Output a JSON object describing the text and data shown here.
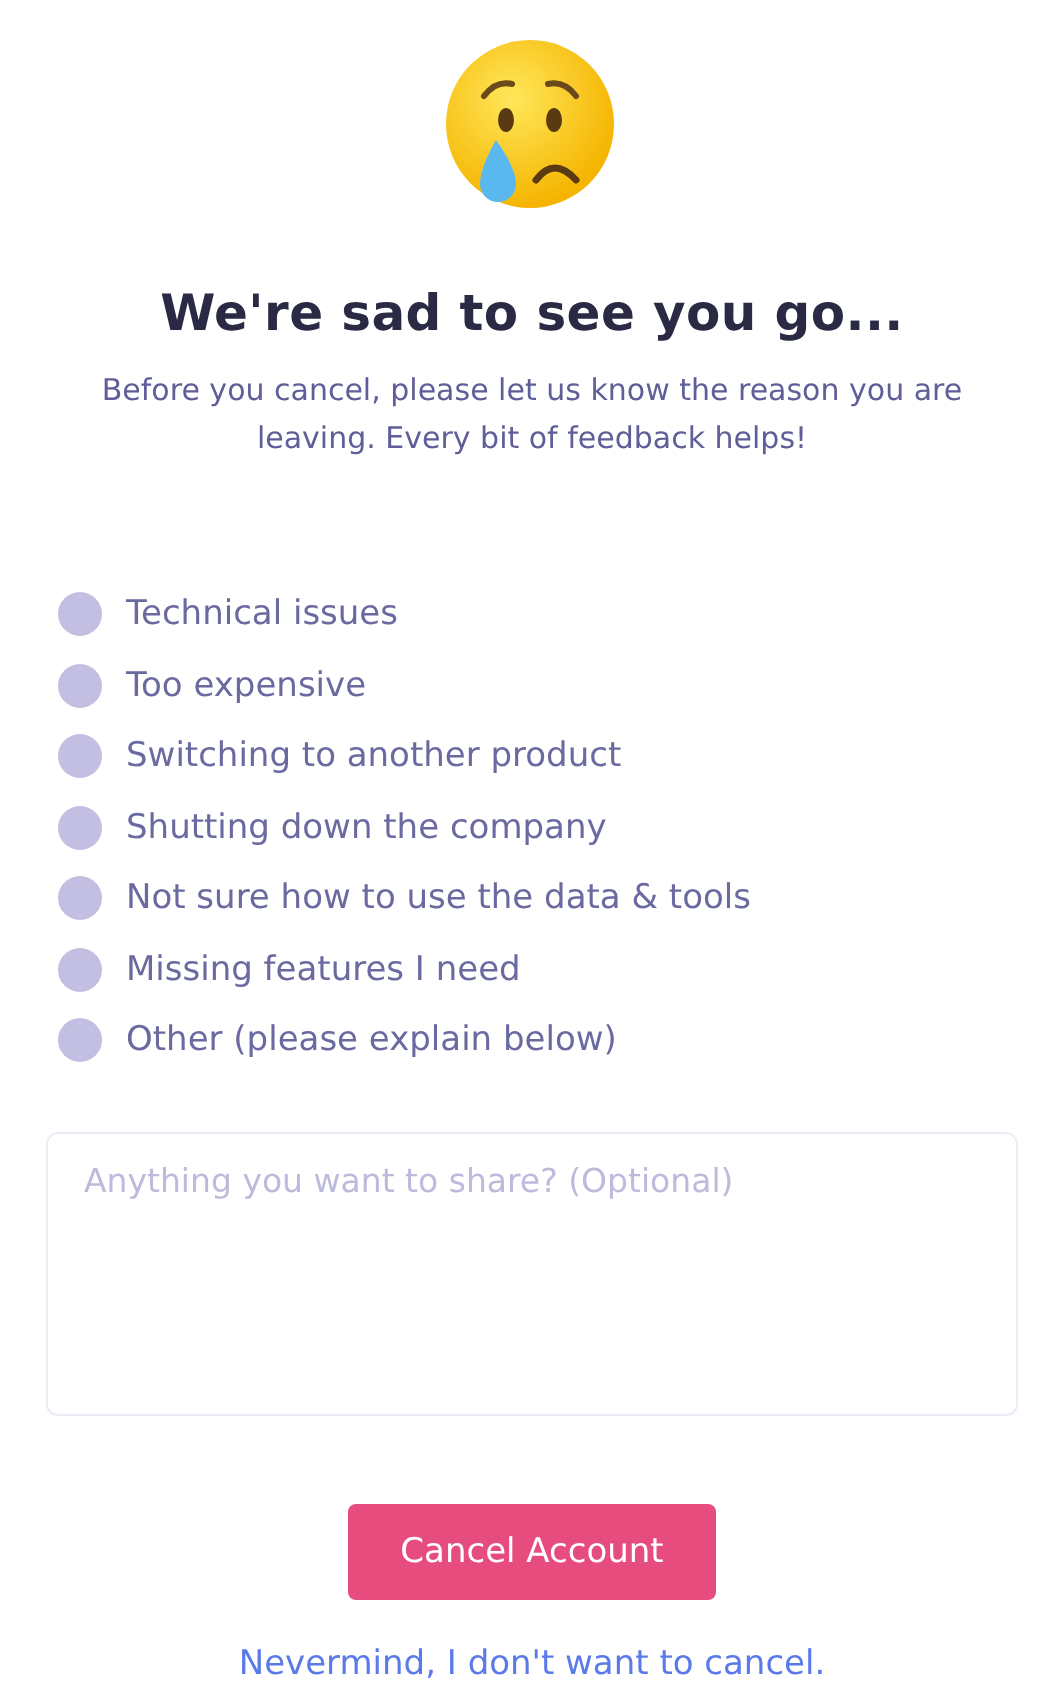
{
  "title": "We're sad to see you go...",
  "subtitle": "Before you cancel, please let us know the reason you are leaving. Every bit of feedback helps!",
  "reasons": [
    {
      "label": "Technical issues",
      "selected": false
    },
    {
      "label": "Too expensive",
      "selected": false
    },
    {
      "label": "Switching to another product",
      "selected": false
    },
    {
      "label": "Shutting down the company",
      "selected": false
    },
    {
      "label": "Not sure how to use the data & tools",
      "selected": false
    },
    {
      "label": "Missing features I need",
      "selected": false
    },
    {
      "label": "Other (please explain below)",
      "selected": false
    }
  ],
  "feedback": {
    "placeholder": "Anything you want to share? (Optional)"
  },
  "cancel_button": "Cancel Account",
  "nevermind_link": "Nevermind, I don't want to cancel."
}
